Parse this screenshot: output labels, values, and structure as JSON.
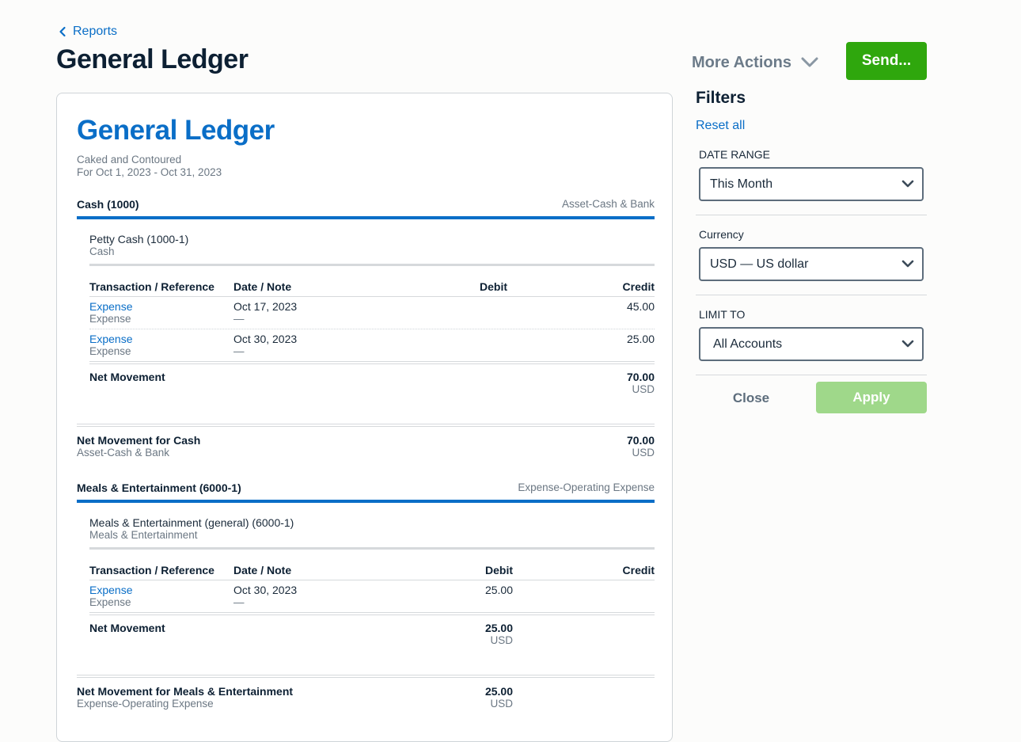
{
  "header": {
    "back_label": "Reports",
    "page_title": "General Ledger",
    "more_actions_label": "More Actions",
    "send_label": "Send..."
  },
  "report": {
    "title": "General Ledger",
    "company": "Caked and Contoured",
    "period": "For Oct 1, 2023 - Oct 31, 2023",
    "sections": [
      {
        "name": "Cash (1000)",
        "type": "Asset-Cash & Bank",
        "sub_name": "Petty Cash (1000-1)",
        "sub_type": "Cash",
        "columns": [
          "Transaction / Reference",
          "Date / Note",
          "Debit",
          "Credit"
        ],
        "rows": [
          {
            "transaction": "Expense",
            "reference": "Expense",
            "date": "Oct 17, 2023",
            "note": "—",
            "debit": "",
            "credit": "45.00"
          },
          {
            "transaction": "Expense",
            "reference": "Expense",
            "date": "Oct 30, 2023",
            "note": "—",
            "debit": "",
            "credit": "25.00"
          }
        ],
        "net_label": "Net Movement",
        "net_value": "70.00",
        "net_currency": "USD",
        "total_label": "Net Movement for Cash",
        "total_type": "Asset-Cash & Bank",
        "total_value": "70.00",
        "total_currency": "USD"
      },
      {
        "name": "Meals & Entertainment (6000-1)",
        "type": "Expense-Operating Expense",
        "sub_name": "Meals & Entertainment (general) (6000-1)",
        "sub_type": "Meals & Entertainment",
        "columns": [
          "Transaction / Reference",
          "Date / Note",
          "Debit",
          "Credit"
        ],
        "rows": [
          {
            "transaction": "Expense",
            "reference": "Expense",
            "date": "Oct 30, 2023",
            "note": "—",
            "debit": "25.00",
            "credit": ""
          }
        ],
        "net_label": "Net Movement",
        "net_value": "25.00",
        "net_currency": "USD",
        "total_label": "Net Movement for Meals & Entertainment",
        "total_type": "Expense-Operating Expense",
        "total_value": "25.00",
        "total_currency": "USD"
      }
    ]
  },
  "filters": {
    "title": "Filters",
    "reset_label": "Reset all",
    "date_range_label": "DATE RANGE",
    "date_range_value": "This Month",
    "currency_label": "Currency",
    "currency_value": "USD — US dollar",
    "limit_label": "LIMIT TO",
    "limit_value": "All Accounts",
    "close_label": "Close",
    "apply_label": "Apply"
  },
  "colors": {
    "accent": "#0a6ec7",
    "send_button": "#2fa70d",
    "apply_disabled": "#9fd88a"
  },
  "icons": {
    "back": "chevron-left-icon",
    "more_actions": "chevron-down-icon",
    "select": "chevron-down-icon"
  }
}
